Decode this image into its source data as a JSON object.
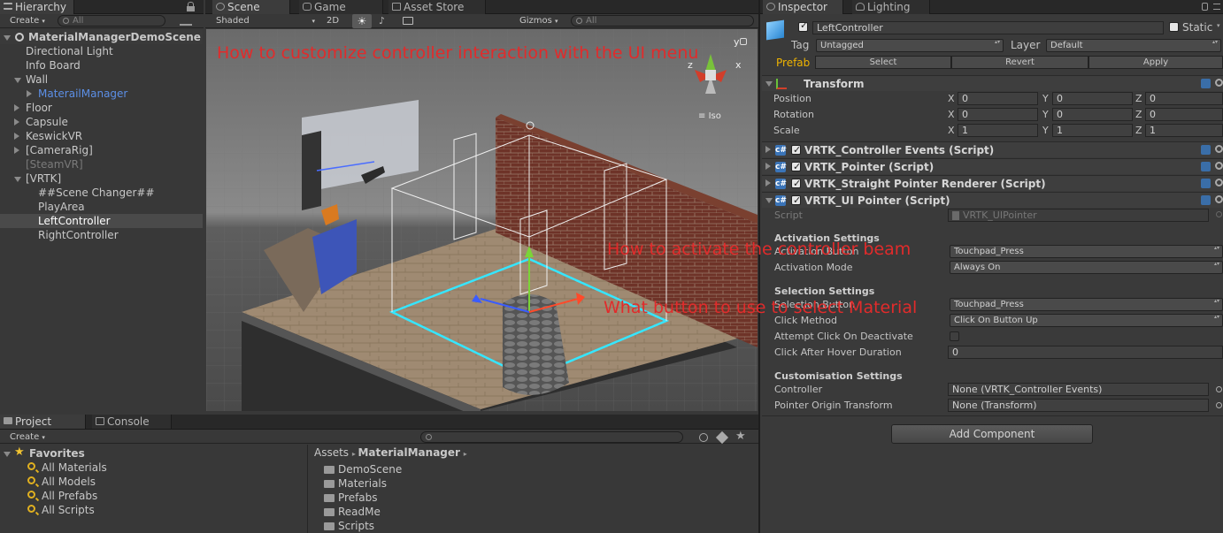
{
  "hierarchy": {
    "tab": "Hierarchy",
    "create": "Create",
    "search_placeholder": "All",
    "scene_name": "MaterialManagerDemoScene",
    "items": [
      {
        "label": "Directional Light",
        "indent": 1,
        "arrow": "none",
        "state": "normal"
      },
      {
        "label": "Info Board",
        "indent": 1,
        "arrow": "none",
        "state": "normal"
      },
      {
        "label": "Wall",
        "indent": 1,
        "arrow": "open",
        "state": "normal"
      },
      {
        "label": "MaterailManager",
        "indent": 2,
        "arrow": "closed",
        "state": "prefab"
      },
      {
        "label": "Floor",
        "indent": 1,
        "arrow": "closed",
        "state": "normal"
      },
      {
        "label": "Capsule",
        "indent": 1,
        "arrow": "closed",
        "state": "normal"
      },
      {
        "label": "KeswickVR",
        "indent": 1,
        "arrow": "closed",
        "state": "normal"
      },
      {
        "label": "[CameraRig]",
        "indent": 1,
        "arrow": "closed",
        "state": "normal"
      },
      {
        "label": "[SteamVR]",
        "indent": 1,
        "arrow": "none",
        "state": "disabled"
      },
      {
        "label": "[VRTK]",
        "indent": 1,
        "arrow": "open",
        "state": "normal"
      },
      {
        "label": "##Scene Changer##",
        "indent": 2,
        "arrow": "none",
        "state": "normal"
      },
      {
        "label": "PlayArea",
        "indent": 2,
        "arrow": "none",
        "state": "normal"
      },
      {
        "label": "LeftController",
        "indent": 2,
        "arrow": "none",
        "state": "selected"
      },
      {
        "label": "RightController",
        "indent": 2,
        "arrow": "none",
        "state": "normal"
      }
    ]
  },
  "scene_tabs": {
    "scene": "Scene",
    "game": "Game",
    "asset_store": "Asset Store"
  },
  "scene_toolbar": {
    "shading": "Shaded",
    "mode_2d": "2D",
    "gizmos": "Gizmos",
    "search_placeholder": "All"
  },
  "scene_view": {
    "gizmo_axes": {
      "y": "y",
      "x": "x",
      "z": "z"
    },
    "projection": "Iso"
  },
  "annotations": {
    "ui_menu": "How to customize controller interaction with the UI menu",
    "beam": "How to activate the controller beam",
    "select": "What button to use to select Material"
  },
  "inspector": {
    "tabs": {
      "inspector": "Inspector",
      "lighting": "Lighting"
    },
    "object_name": "LeftController",
    "static_label": "Static",
    "tag_label": "Tag",
    "tag_value": "Untagged",
    "layer_label": "Layer",
    "layer_value": "Default",
    "prefab_label": "Prefab",
    "prefab_buttons": {
      "select": "Select",
      "revert": "Revert",
      "apply": "Apply"
    },
    "transform": {
      "title": "Transform",
      "rows": [
        {
          "label": "Position",
          "x": "0",
          "y": "0",
          "z": "0"
        },
        {
          "label": "Rotation",
          "x": "0",
          "y": "0",
          "z": "0"
        },
        {
          "label": "Scale",
          "x": "1",
          "y": "1",
          "z": "1"
        }
      ],
      "axis_labels": {
        "x": "X",
        "y": "Y",
        "z": "Z"
      }
    },
    "components": [
      "VRTK_Controller Events (Script)",
      "VRTK_Pointer (Script)",
      "VRTK_Straight Pointer Renderer (Script)",
      "VRTK_UI Pointer (Script)"
    ],
    "script_label": "Script",
    "script_value": "VRTK_UIPointer",
    "activation": {
      "header": "Activation Settings",
      "button_label": "Activation Button",
      "button_value": "Touchpad_Press",
      "mode_label": "Activation Mode",
      "mode_value": "Always On"
    },
    "selection": {
      "header": "Selection Settings",
      "button_label": "Selection Button",
      "button_value": "Touchpad_Press",
      "click_label": "Click Method",
      "click_value": "Click On Button Up",
      "attempt_label": "Attempt Click On Deactivate",
      "hover_label": "Click After Hover Duration",
      "hover_value": "0"
    },
    "customisation": {
      "header": "Customisation Settings",
      "controller_label": "Controller",
      "controller_value": "None (VRTK_Controller Events)",
      "origin_label": "Pointer Origin Transform",
      "origin_value": "None (Transform)"
    },
    "add_component": "Add Component"
  },
  "project": {
    "tabs": {
      "project": "Project",
      "console": "Console"
    },
    "create": "Create",
    "favorites_label": "Favorites",
    "favorites": [
      "All Materials",
      "All Models",
      "All Prefabs",
      "All Scripts"
    ],
    "breadcrumb": {
      "root": "Assets",
      "current": "MaterialManager"
    },
    "folders": [
      "DemoScene",
      "Materials",
      "Prefabs",
      "ReadMe",
      "Scripts"
    ]
  },
  "colors": {
    "annotation": "#e12b2b",
    "selection": "#3e5f96",
    "prefab_text": "#5c8fe6",
    "floor_outline": "#35e6ff"
  }
}
